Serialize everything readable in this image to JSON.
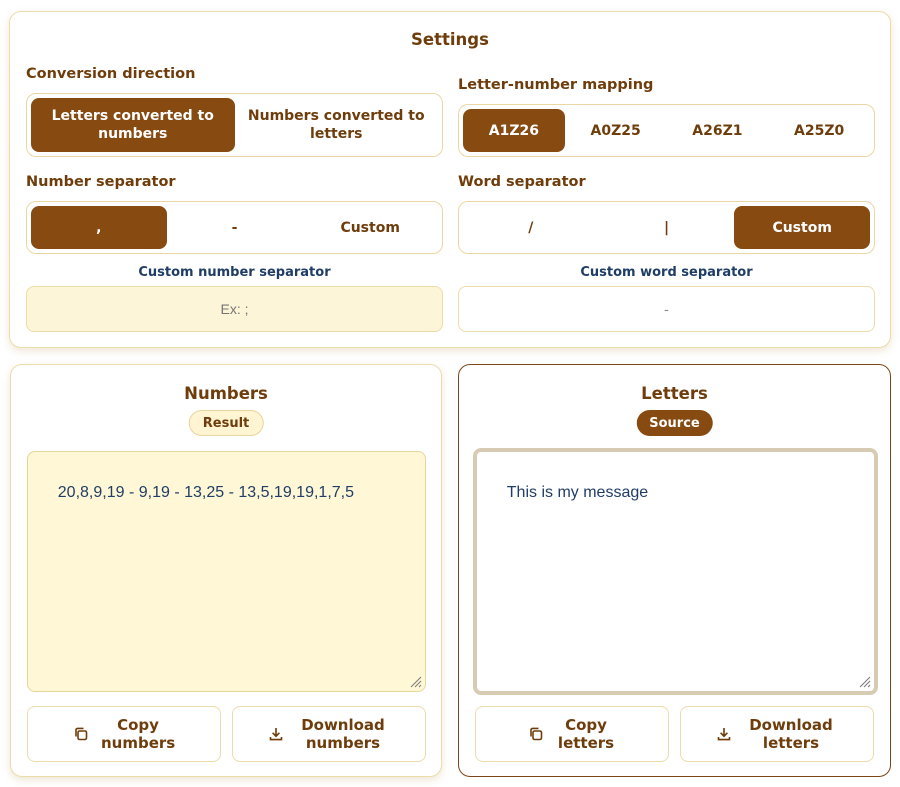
{
  "settings": {
    "title": "Settings",
    "conversion_direction": {
      "label": "Conversion direction",
      "options": [
        "Letters converted to numbers",
        "Numbers converted to letters"
      ],
      "selected": "Letters converted to numbers"
    },
    "mapping": {
      "label": "Letter-number mapping",
      "options": [
        "A1Z26",
        "A0Z25",
        "A26Z1",
        "A25Z0"
      ],
      "selected": "A1Z26"
    },
    "number_separator": {
      "label": "Number separator",
      "options": [
        ",",
        "-",
        "Custom"
      ],
      "selected": ","
    },
    "word_separator": {
      "label": "Word separator",
      "options": [
        "/",
        "|",
        "Custom"
      ],
      "selected": "Custom"
    },
    "custom_number_separator": {
      "label": "Custom number separator",
      "value": "",
      "placeholder": "Ex: ;"
    },
    "custom_word_separator": {
      "label": "Custom word separator",
      "value": "-"
    }
  },
  "numbers_panel": {
    "title": "Numbers",
    "badge": "Result",
    "text": "20,8,9,19 - 9,19 - 13,25 - 13,5,19,19,1,7,5",
    "copy_label": "Copy numbers",
    "download_label": "Download numbers"
  },
  "letters_panel": {
    "title": "Letters",
    "badge": "Source",
    "text": "This is my message",
    "copy_label": "Copy letters",
    "download_label": "Download letters"
  },
  "colors": {
    "accent": "#874b12",
    "heading": "#6e3d0b",
    "sublabel": "#1f3d66",
    "field_bg": "#fff7d6",
    "border": "#ecdcaa"
  }
}
